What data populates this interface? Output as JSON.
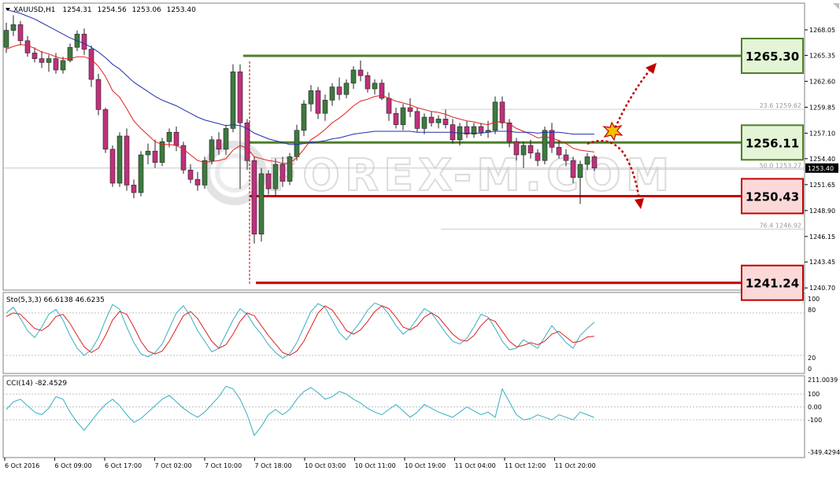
{
  "header": {
    "symbol": "XAUUSD,H1",
    "open": "1254.31",
    "high": "1254.56",
    "low": "1253.06",
    "close": "1253.40"
  },
  "watermark": "FOREX-M.COM",
  "price_axis_ticks": [
    "1268.05",
    "1265.35",
    "1262.60",
    "1259.85",
    "1257.10",
    "1254.40",
    "1251.65",
    "1248.90",
    "1246.15",
    "1243.45",
    "1240.70"
  ],
  "current_price": "1253.40",
  "levels": [
    {
      "label": "1265.30",
      "price": 1265.3,
      "kind": "resistance",
      "color": "#4f7f2a",
      "box_fill": "#e3f5d6"
    },
    {
      "label": "1256.11",
      "price": 1256.11,
      "kind": "pivot",
      "color": "#4f7f2a",
      "box_fill": "#e3f5d6"
    },
    {
      "label": "1250.43",
      "price": 1250.43,
      "kind": "support",
      "color": "#c00000",
      "box_fill": "#fbd9d9"
    },
    {
      "label": "1241.24",
      "price": 1241.24,
      "kind": "support",
      "color": "#c00000",
      "box_fill": "#fbd9d9"
    }
  ],
  "fib_labels": [
    {
      "text": "23.6 1259.62",
      "price": 1259.62
    },
    {
      "text": "50.0 1253.27",
      "price": 1253.27
    },
    {
      "text": "76.4 1246.92",
      "price": 1246.92
    }
  ],
  "time_labels": [
    "6 Oct 2016",
    "6 Oct 09:00",
    "6 Oct 17:00",
    "7 Oct 02:00",
    "7 Oct 10:00",
    "7 Oct 18:00",
    "10 Oct 03:00",
    "10 Oct 11:00",
    "10 Oct 19:00",
    "11 Oct 04:00",
    "11 Oct 12:00",
    "11 Oct 20:00"
  ],
  "stochastic": {
    "label": "Sto(5,3,3) 66.6138 46.6235",
    "levels": [
      "100",
      "80",
      "20",
      "0"
    ]
  },
  "cci": {
    "label": "CCI(14) -82.4529",
    "levels": [
      "211.0039",
      "100",
      "0.00",
      "-100",
      "-349.4294"
    ]
  },
  "colors": {
    "bull": "#3d7a3f",
    "bear": "#c0307c",
    "ma_fast": "#e02020",
    "ma_slow": "#2030b0",
    "sto_main": "#39aec2",
    "sto_signal": "#e02020",
    "cci": "#39aec2"
  },
  "chart_data": {
    "type": "candlestick",
    "instrument": "XAUUSD",
    "timeframe": "H1",
    "ylim": [
      1239.8,
      1270.6
    ],
    "candles": [
      [
        1266.2,
        1268.8,
        1265.6,
        1268.0
      ],
      [
        1268.0,
        1269.6,
        1267.4,
        1268.6
      ],
      [
        1268.6,
        1269.0,
        1266.4,
        1266.9
      ],
      [
        1266.9,
        1267.4,
        1265.2,
        1265.6
      ],
      [
        1265.6,
        1266.2,
        1264.6,
        1265.0
      ],
      [
        1265.0,
        1265.8,
        1264.0,
        1264.6
      ],
      [
        1264.6,
        1265.4,
        1263.6,
        1265.0
      ],
      [
        1265.0,
        1265.6,
        1263.4,
        1263.8
      ],
      [
        1263.8,
        1265.2,
        1263.4,
        1264.8
      ],
      [
        1264.8,
        1266.6,
        1264.6,
        1266.2
      ],
      [
        1266.2,
        1268.0,
        1265.8,
        1267.6
      ],
      [
        1267.6,
        1268.2,
        1265.4,
        1266.0
      ],
      [
        1266.0,
        1266.4,
        1262.0,
        1262.8
      ],
      [
        1262.8,
        1263.4,
        1259.0,
        1259.6
      ],
      [
        1259.6,
        1259.8,
        1255.0,
        1255.4
      ],
      [
        1255.4,
        1255.8,
        1251.4,
        1251.8
      ],
      [
        1251.8,
        1257.2,
        1251.4,
        1256.8
      ],
      [
        1256.8,
        1257.6,
        1251.0,
        1251.6
      ],
      [
        1251.6,
        1252.2,
        1250.2,
        1250.8
      ],
      [
        1250.8,
        1255.2,
        1250.4,
        1254.8
      ],
      [
        1254.8,
        1256.0,
        1253.8,
        1255.2
      ],
      [
        1255.2,
        1256.4,
        1253.4,
        1254.0
      ],
      [
        1254.0,
        1256.6,
        1253.6,
        1256.2
      ],
      [
        1256.2,
        1257.6,
        1255.6,
        1257.2
      ],
      [
        1257.2,
        1257.8,
        1255.2,
        1255.8
      ],
      [
        1255.8,
        1256.2,
        1252.8,
        1253.2
      ],
      [
        1253.2,
        1253.8,
        1251.8,
        1252.2
      ],
      [
        1252.2,
        1253.0,
        1251.0,
        1251.6
      ],
      [
        1251.6,
        1254.6,
        1251.2,
        1254.2
      ],
      [
        1254.2,
        1256.8,
        1253.8,
        1256.4
      ],
      [
        1256.4,
        1257.2,
        1254.8,
        1255.4
      ],
      [
        1255.4,
        1258.0,
        1254.8,
        1257.6
      ],
      [
        1257.6,
        1264.4,
        1257.2,
        1263.6
      ],
      [
        1263.6,
        1264.4,
        1251.2,
        1258.2
      ],
      [
        1258.2,
        1258.6,
        1253.2,
        1254.2
      ],
      [
        1254.2,
        1254.6,
        1245.4,
        1246.4
      ],
      [
        1246.4,
        1253.4,
        1245.6,
        1252.8
      ],
      [
        1252.8,
        1253.2,
        1250.6,
        1251.2
      ],
      [
        1251.2,
        1254.4,
        1250.4,
        1253.8
      ],
      [
        1253.8,
        1254.6,
        1251.4,
        1252.0
      ],
      [
        1252.0,
        1255.0,
        1251.6,
        1254.6
      ],
      [
        1254.6,
        1258.0,
        1254.2,
        1257.4
      ],
      [
        1257.4,
        1260.6,
        1256.8,
        1260.2
      ],
      [
        1260.2,
        1262.2,
        1259.4,
        1261.6
      ],
      [
        1261.6,
        1262.0,
        1258.6,
        1259.2
      ],
      [
        1259.2,
        1261.2,
        1258.4,
        1260.6
      ],
      [
        1260.6,
        1262.4,
        1260.0,
        1262.0
      ],
      [
        1262.0,
        1263.0,
        1260.6,
        1261.2
      ],
      [
        1261.2,
        1262.8,
        1260.8,
        1262.4
      ],
      [
        1262.4,
        1264.2,
        1261.8,
        1263.8
      ],
      [
        1263.8,
        1264.8,
        1262.6,
        1263.2
      ],
      [
        1263.2,
        1263.6,
        1261.4,
        1261.8
      ],
      [
        1261.8,
        1262.8,
        1261.2,
        1262.4
      ],
      [
        1262.4,
        1262.8,
        1260.6,
        1260.8
      ],
      [
        1260.8,
        1261.4,
        1258.4,
        1259.2
      ],
      [
        1259.2,
        1259.8,
        1257.6,
        1258.0
      ],
      [
        1258.0,
        1260.2,
        1257.4,
        1259.8
      ],
      [
        1259.8,
        1260.8,
        1258.8,
        1259.4
      ],
      [
        1259.4,
        1259.8,
        1257.2,
        1257.6
      ],
      [
        1257.6,
        1259.2,
        1257.0,
        1258.8
      ],
      [
        1258.8,
        1259.4,
        1257.8,
        1258.2
      ],
      [
        1258.2,
        1259.0,
        1257.6,
        1258.6
      ],
      [
        1258.6,
        1259.6,
        1257.6,
        1258.0
      ],
      [
        1258.0,
        1258.6,
        1256.0,
        1256.4
      ],
      [
        1256.4,
        1258.2,
        1255.8,
        1257.8
      ],
      [
        1257.8,
        1258.4,
        1256.6,
        1257.0
      ],
      [
        1257.0,
        1258.2,
        1256.6,
        1257.8
      ],
      [
        1257.8,
        1258.2,
        1256.8,
        1257.2
      ],
      [
        1257.2,
        1258.4,
        1256.6,
        1257.4
      ],
      [
        1257.4,
        1261.0,
        1257.0,
        1260.4
      ],
      [
        1260.4,
        1261.0,
        1257.6,
        1258.2
      ],
      [
        1258.2,
        1258.6,
        1255.6,
        1256.2
      ],
      [
        1256.2,
        1256.6,
        1254.2,
        1254.8
      ],
      [
        1254.8,
        1256.2,
        1253.4,
        1255.8
      ],
      [
        1255.8,
        1256.4,
        1254.4,
        1255.0
      ],
      [
        1255.0,
        1255.4,
        1253.6,
        1254.2
      ],
      [
        1254.2,
        1257.8,
        1253.8,
        1257.4
      ],
      [
        1257.4,
        1258.2,
        1255.0,
        1255.6
      ],
      [
        1255.6,
        1256.4,
        1254.4,
        1254.8
      ],
      [
        1254.8,
        1255.4,
        1253.6,
        1254.2
      ],
      [
        1254.2,
        1254.6,
        1251.8,
        1252.4
      ],
      [
        1252.4,
        1254.2,
        1249.6,
        1253.8
      ],
      [
        1253.8,
        1255.0,
        1253.2,
        1254.6
      ],
      [
        1254.6,
        1254.8,
        1253.1,
        1253.4
      ]
    ],
    "ma_fast": [
      1266.0,
      1266.3,
      1266.5,
      1266.4,
      1266.1,
      1265.7,
      1265.5,
      1265.2,
      1265.0,
      1265.0,
      1265.2,
      1265.2,
      1264.9,
      1264.2,
      1263.1,
      1261.6,
      1260.9,
      1259.7,
      1258.4,
      1257.6,
      1256.9,
      1256.2,
      1255.9,
      1255.9,
      1255.8,
      1255.4,
      1254.8,
      1254.2,
      1254.0,
      1254.1,
      1254.2,
      1254.4,
      1255.3,
      1255.8,
      1255.5,
      1254.6,
      1254.4,
      1254.2,
      1254.1,
      1253.9,
      1253.9,
      1254.5,
      1255.4,
      1256.4,
      1256.9,
      1257.5,
      1258.2,
      1258.7,
      1259.3,
      1260.0,
      1260.5,
      1260.7,
      1261.0,
      1261.1,
      1260.8,
      1260.5,
      1260.3,
      1260.1,
      1259.8,
      1259.6,
      1259.4,
      1259.3,
      1259.1,
      1258.8,
      1258.6,
      1258.4,
      1258.3,
      1258.1,
      1258.0,
      1258.3,
      1258.3,
      1258.1,
      1257.6,
      1257.3,
      1257.0,
      1256.6,
      1256.7,
      1256.6,
      1256.3,
      1256.0,
      1255.5,
      1255.3,
      1255.2,
      1255.1
    ],
    "ma_slow": [
      1270.2,
      1270.0,
      1269.8,
      1269.5,
      1269.2,
      1268.8,
      1268.4,
      1268.0,
      1267.6,
      1267.2,
      1266.9,
      1266.6,
      1266.2,
      1265.7,
      1265.1,
      1264.4,
      1263.9,
      1263.2,
      1262.5,
      1262.0,
      1261.5,
      1261.0,
      1260.6,
      1260.3,
      1260.0,
      1259.6,
      1259.2,
      1258.8,
      1258.5,
      1258.3,
      1258.1,
      1257.9,
      1258.0,
      1257.9,
      1257.6,
      1257.1,
      1256.8,
      1256.5,
      1256.3,
      1256.1,
      1255.9,
      1255.9,
      1256.0,
      1256.1,
      1256.2,
      1256.3,
      1256.5,
      1256.6,
      1256.8,
      1257.0,
      1257.1,
      1257.2,
      1257.3,
      1257.3,
      1257.3,
      1257.3,
      1257.3,
      1257.3,
      1257.2,
      1257.2,
      1257.2,
      1257.2,
      1257.2,
      1257.2,
      1257.1,
      1257.1,
      1257.1,
      1257.1,
      1257.2,
      1257.3,
      1257.3,
      1257.3,
      1257.2,
      1257.2,
      1257.2,
      1257.1,
      1257.2,
      1257.2,
      1257.2,
      1257.1,
      1257.0,
      1257.0,
      1257.0,
      1257.0
    ],
    "stochastic_main": [
      80,
      88,
      72,
      55,
      45,
      60,
      78,
      85,
      70,
      48,
      30,
      20,
      28,
      45,
      70,
      92,
      85,
      60,
      38,
      22,
      18,
      24,
      36,
      58,
      80,
      90,
      75,
      55,
      40,
      25,
      30,
      50,
      70,
      86,
      78,
      62,
      50,
      35,
      24,
      16,
      22,
      38,
      60,
      82,
      93,
      88,
      70,
      52,
      42,
      55,
      68,
      84,
      94,
      90,
      78,
      62,
      50,
      58,
      72,
      86,
      80,
      66,
      52,
      40,
      36,
      44,
      60,
      78,
      74,
      58,
      40,
      28,
      30,
      42,
      36,
      30,
      46,
      62,
      50,
      38,
      30,
      48,
      58,
      67
    ],
    "stochastic_signal": [
      75,
      80,
      78,
      68,
      58,
      55,
      62,
      75,
      78,
      65,
      48,
      32,
      24,
      30,
      48,
      70,
      82,
      78,
      60,
      40,
      26,
      22,
      26,
      40,
      58,
      76,
      82,
      72,
      56,
      40,
      30,
      35,
      50,
      68,
      80,
      76,
      62,
      48,
      36,
      24,
      20,
      26,
      40,
      60,
      80,
      90,
      84,
      70,
      55,
      50,
      56,
      68,
      82,
      90,
      86,
      74,
      60,
      56,
      62,
      74,
      80,
      74,
      62,
      50,
      42,
      40,
      48,
      62,
      72,
      68,
      54,
      40,
      32,
      34,
      38,
      35,
      40,
      50,
      54,
      46,
      38,
      40,
      46,
      47
    ],
    "cci": [
      -20,
      40,
      60,
      10,
      -40,
      -60,
      -10,
      80,
      60,
      -40,
      -120,
      -180,
      -110,
      -40,
      20,
      60,
      10,
      -60,
      -120,
      -90,
      -40,
      10,
      60,
      90,
      40,
      -10,
      -50,
      -80,
      -40,
      20,
      80,
      160,
      140,
      60,
      -60,
      -220,
      -150,
      -60,
      -20,
      -60,
      -20,
      60,
      120,
      150,
      110,
      60,
      80,
      120,
      100,
      60,
      30,
      -10,
      -40,
      -60,
      -20,
      20,
      -30,
      -80,
      -40,
      20,
      -10,
      -40,
      -60,
      -80,
      -40,
      0,
      -30,
      -60,
      -40,
      -80,
      140,
      40,
      -60,
      -100,
      -90,
      -60,
      -80,
      -100,
      -60,
      -80,
      -100,
      -40,
      -60,
      -82
    ]
  }
}
